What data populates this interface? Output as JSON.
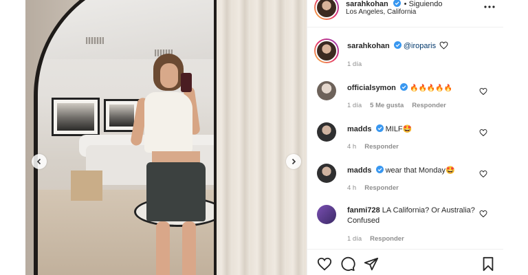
{
  "post": {
    "author": "sarahkohan",
    "follow_status": "• Siguiendo",
    "location": "Los Angeles, California"
  },
  "caption": {
    "author": "sarahkohan",
    "text": "@iroparis",
    "time": "1 día"
  },
  "comments": [
    {
      "author": "officialsymon",
      "text": "🔥🔥🔥🔥🔥",
      "time": "1 día",
      "likes": "5 Me gusta",
      "reply": "Responder",
      "verified": true
    },
    {
      "author": "madds",
      "text": "MILF🤩",
      "time": "4 h",
      "likes": "",
      "reply": "Responder",
      "verified": true
    },
    {
      "author": "madds",
      "text": "wear that Monday🤩",
      "time": "4 h",
      "likes": "",
      "reply": "Responder",
      "verified": true
    },
    {
      "author": "fanmi728",
      "text": "LA California? Or Australia? Confused",
      "time": "1 día",
      "likes": "",
      "reply": "Responder",
      "verified": false
    }
  ],
  "icons": {
    "caption_heart": "heart-outline-icon",
    "like": "heart-icon",
    "comment": "comment-icon",
    "share": "share-icon",
    "save": "bookmark-icon",
    "more": "more-icon",
    "verified": "verified-badge-icon"
  },
  "colors": {
    "verified": "#3897f0",
    "meta": "#8e8e8e",
    "text": "#262626"
  }
}
